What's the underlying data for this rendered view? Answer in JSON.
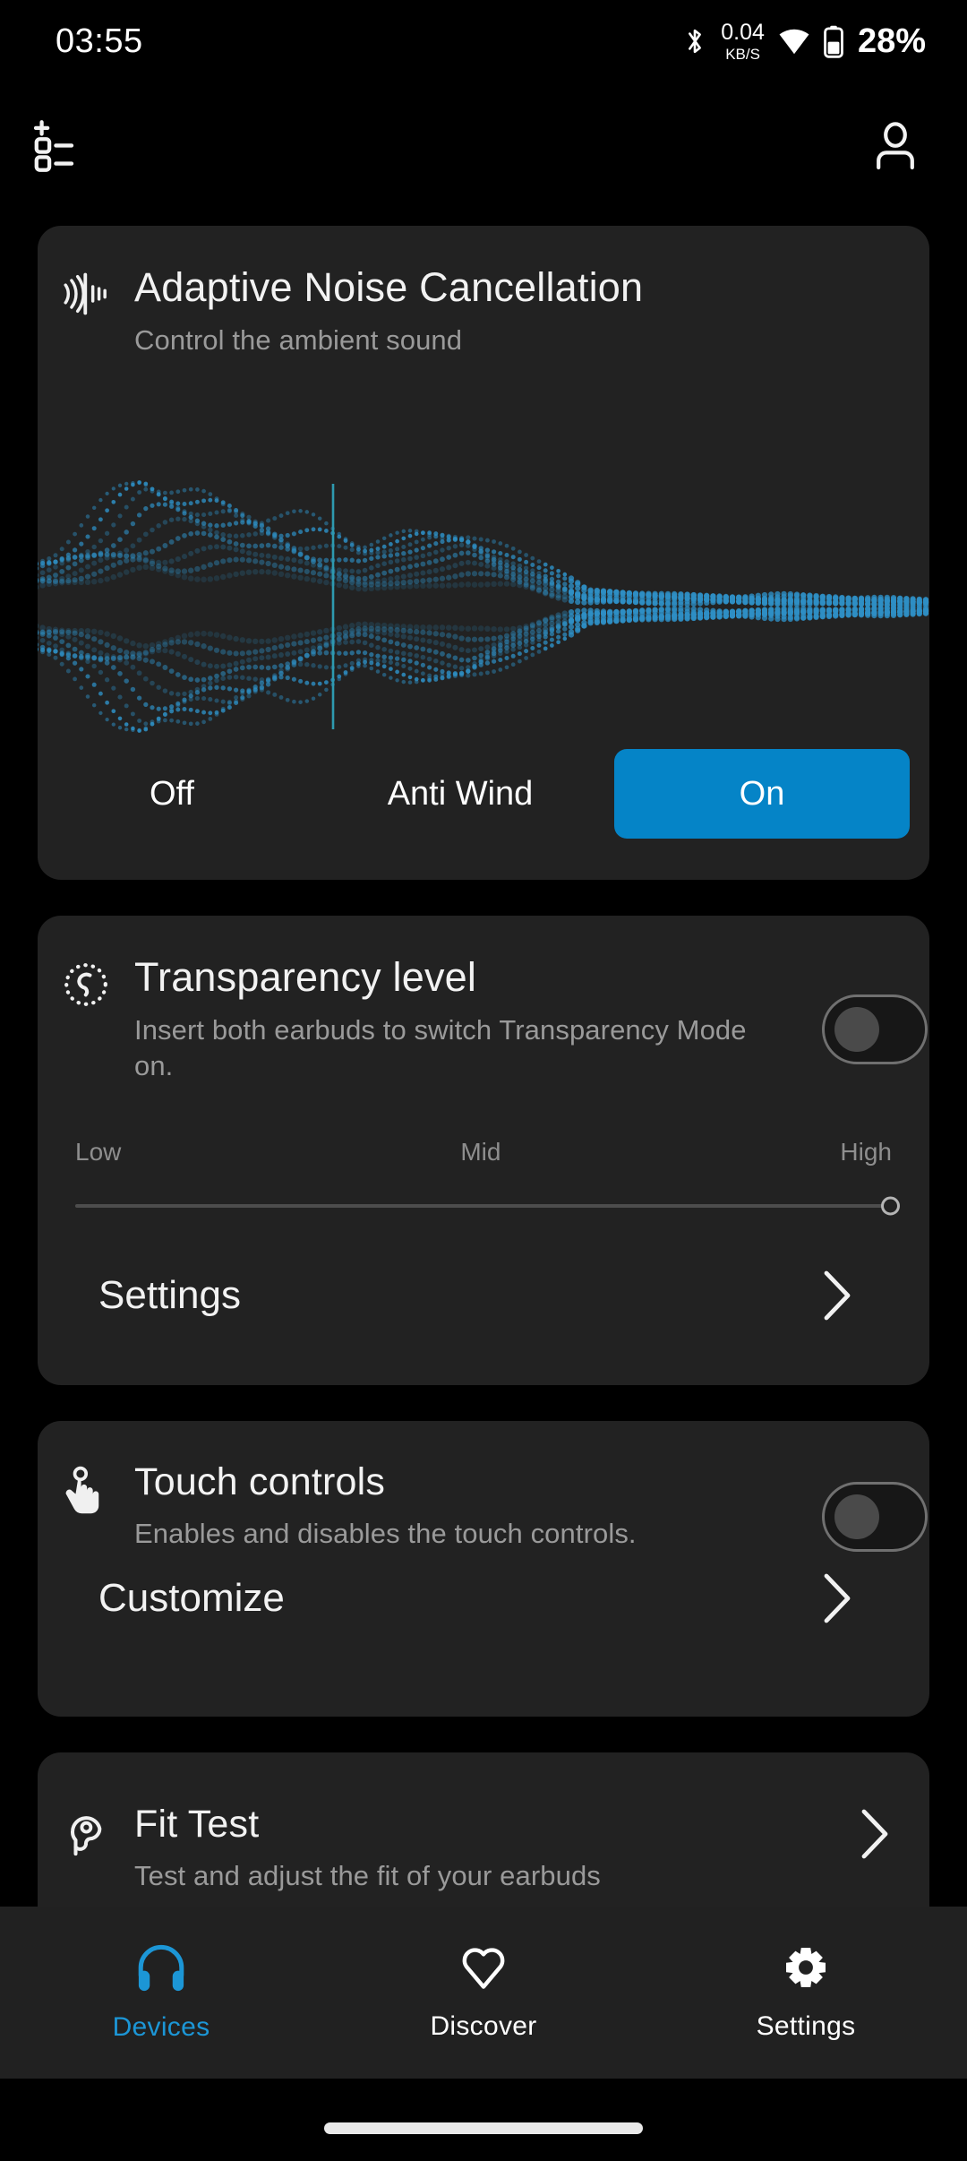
{
  "status_bar": {
    "time": "03:55",
    "bluetooth_icon": "bluetooth-icon",
    "net_speed_value": "0.04",
    "net_speed_unit": "KB/S",
    "wifi_icon": "wifi-icon",
    "battery_icon": "battery-icon",
    "battery_percent": "28%"
  },
  "app_bar": {
    "add_device_icon": "add-device-list-icon",
    "account_icon": "account-person-icon"
  },
  "anc_card": {
    "icon": "noise-cancellation-wave-icon",
    "title": "Adaptive Noise Cancellation",
    "subtitle": "Control the ambient sound",
    "modes": [
      {
        "label": "Off",
        "active": false
      },
      {
        "label": "Anti Wind",
        "active": false
      },
      {
        "label": "On",
        "active": true
      }
    ],
    "active_color": "#0584C7",
    "waveform_color": "#2E8FC4",
    "playhead_color": "#2E9AB0"
  },
  "transparency_card": {
    "icon": "transparency-ear-icon",
    "title": "Transparency level",
    "subtitle": "Insert both earbuds to switch Transparency Mode on.",
    "toggle": {
      "name": "transparency-toggle",
      "state": "off"
    },
    "slider": {
      "labels": [
        "Low",
        "Mid",
        "High"
      ],
      "value_label": "High",
      "position_percent": 100
    },
    "settings_link": {
      "label": "Settings",
      "chevron": "chevron-right-icon"
    }
  },
  "touch_card": {
    "icon": "touch-hand-icon",
    "title": "Touch controls",
    "subtitle": "Enables and disables the touch controls.",
    "toggle": {
      "name": "touch-controls-toggle",
      "state": "off"
    },
    "customize_link": {
      "label": "Customize",
      "chevron": "chevron-right-icon"
    }
  },
  "fit_card": {
    "icon": "fit-test-ear-icon",
    "title": "Fit Test",
    "subtitle": "Test and adjust the fit of your earbuds",
    "chevron": "chevron-right-icon"
  },
  "bottom_nav": {
    "active_color": "#1C96D6",
    "items": [
      {
        "label": "Devices",
        "icon": "headphones-icon",
        "active": true
      },
      {
        "label": "Discover",
        "icon": "heart-icon",
        "active": false
      },
      {
        "label": "Settings",
        "icon": "gear-icon",
        "active": false
      }
    ]
  }
}
